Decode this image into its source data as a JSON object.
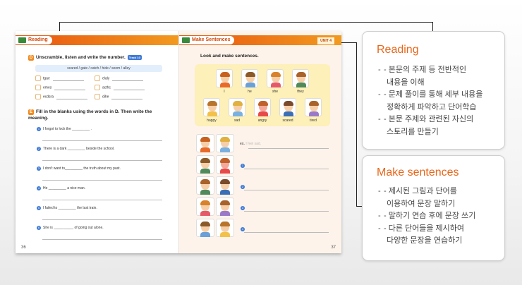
{
  "left_page": {
    "banner_label": "Reading",
    "section_d": {
      "letter": "D",
      "title": "Unscramble, listen and write the number.",
      "track": "Track 10",
      "word_bank": "scared  /  gate  /  catch  /  hide  /  seem  /  alley",
      "scrambles": [
        "tgae",
        "emes",
        "ecdsra",
        "elaly",
        "acthc",
        "dihe"
      ]
    },
    "section_e": {
      "letter": "E",
      "title": "Fill in the blanks using the words in D. Then write the meaning.",
      "sentences": [
        "I forgot to lock the _________ .",
        "There is a dark _________ beside the school.",
        "I don't want to_________ the truth about my past.",
        "He _________ a nice man.",
        "I failed to _________ the last train.",
        "She is __________ of going out alone."
      ],
      "numbers": [
        "1",
        "2",
        "3",
        "4",
        "5",
        "6"
      ]
    },
    "page_number": "36"
  },
  "right_page": {
    "banner_label": "Make Sentences",
    "unit_tag": "UNIT 4",
    "instruction": "Look and make sentences.",
    "pronouns": [
      "I",
      "he",
      "she",
      "they"
    ],
    "feelings": [
      "happy",
      "sad",
      "angry",
      "scared",
      "tired"
    ],
    "example_label": "ex.",
    "example_sentence": "I feel sad.",
    "answer_numbers": [
      "1",
      "2",
      "3",
      "4"
    ],
    "page_number": "37"
  },
  "reading_card": {
    "title": "Reading",
    "items": [
      [
        "- 본문의 주제 등 전반적인",
        "내용을 이해"
      ],
      [
        "- 문제 풀이를 통해 세부 내용을",
        "정확하게 파악하고 단어학습"
      ],
      [
        "- 본문 주제와 관련된 자신의",
        "스토리를 만들기"
      ]
    ]
  },
  "make_card": {
    "title": "Make sentences",
    "items": [
      [
        "- 제시된 그림과 단어를",
        "이용하여 문장 말하기"
      ],
      [
        "- 말하기 연습 후에 문장 쓰기"
      ],
      [
        "- 다른 단어들을 제시하여",
        "다양한 문장을 연습하기"
      ]
    ]
  },
  "colors": {
    "accent_orange": "#e8661a",
    "banner_orange": "#e8530f",
    "connector": "#222222"
  }
}
